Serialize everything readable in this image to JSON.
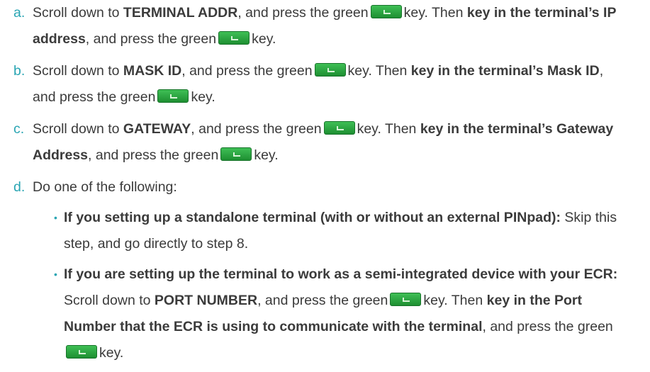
{
  "steps": [
    {
      "letter": "a.",
      "p1": "Scroll down to ",
      "b1": "TERMINAL ADDR",
      "p2": ", and press the green",
      "p3": "key. Then ",
      "b2": "key in the terminal’s IP address",
      "p4": ", and press the green",
      "p5": "key."
    },
    {
      "letter": "b.",
      "p1": "Scroll down to ",
      "b1": "MASK ID",
      "p2": ", and press the green",
      "p3": "key. Then ",
      "b2": "key in the terminal’s Mask ID",
      "p4": ", and press the green",
      "p5": "key."
    },
    {
      "letter": "c.",
      "p1": "Scroll down to ",
      "b1": "GATEWAY",
      "p2": ", and press the green",
      "p3": "key. Then ",
      "b2": "key in the terminal’s Gateway Address",
      "p4": ", and press the green",
      "p5": "key."
    }
  ],
  "step_d": {
    "letter": "d.",
    "text": "Do one of the following:",
    "bullet_glyph": "•",
    "option1": {
      "bold": "If you setting up a standalone terminal (with or without an external PINpad):",
      "text": " Skip this step, and go directly to step 8."
    },
    "option2": {
      "bold": "If you are setting up the terminal to work as a semi-integrated device with your ECR:",
      "p1": " Scroll down to ",
      "b1": "PORT NUMBER",
      "p2": ", and press the green",
      "p3": "key. Then ",
      "b2": "key in the Port Number that the ECR is using to communicate with the terminal",
      "p4": ", and press the green",
      "p5": "key."
    }
  },
  "key_icon": "green-enter-key-icon",
  "colors": {
    "accent": "#2aa5b3",
    "key_green": "#2a9d3c",
    "text": "#3b3b3b"
  }
}
